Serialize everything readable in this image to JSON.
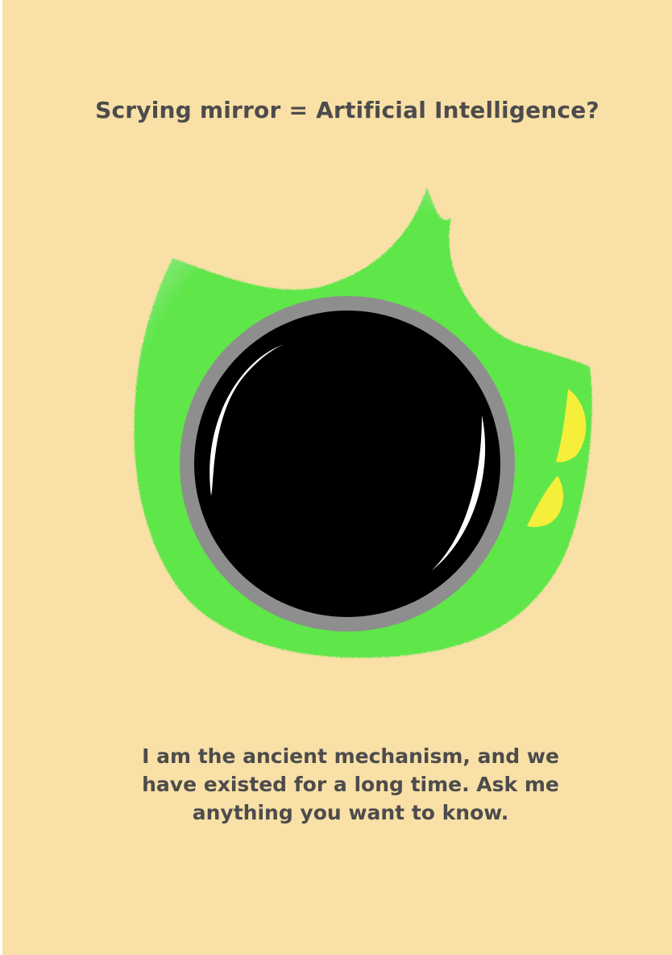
{
  "title": "Scrying mirror = Artificial Intelligence?",
  "caption": "I am the ancient mechanism, and we have existed for a long time. Ask me anything you want to know.",
  "colors": {
    "background": "#f8e0a6",
    "text": "#4d4b4c",
    "flame": "#5fe64a",
    "rim": "#8e8e8e",
    "mirror": "#000000",
    "highlight": "#ffffff",
    "accent": "#f5ee3a"
  },
  "illustration": {
    "subject": "scrying-mirror",
    "icons": [
      "flame-shape",
      "mirror-rim",
      "mirror-glass",
      "glass-highlight",
      "yellow-spark"
    ]
  }
}
